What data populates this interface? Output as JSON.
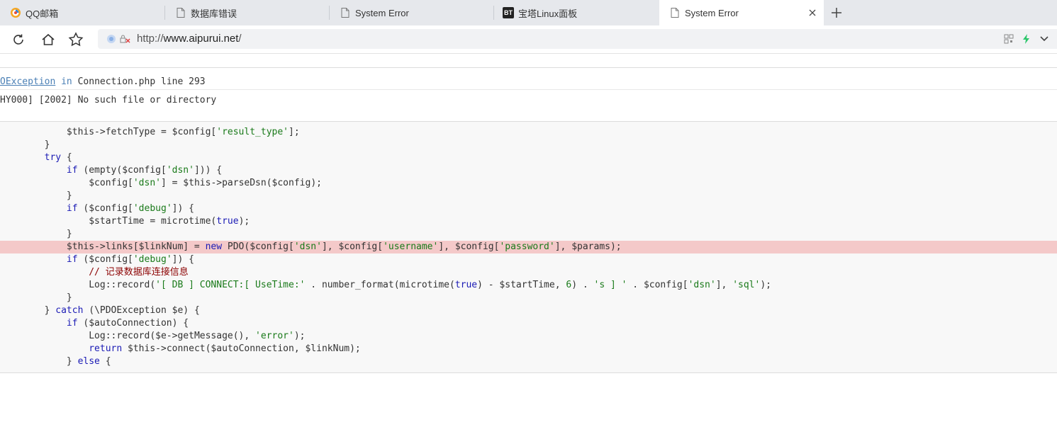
{
  "tabs": [
    {
      "label": "QQ邮箱",
      "icon": "qq-mail-icon"
    },
    {
      "label": "数据库错误",
      "icon": "page-icon"
    },
    {
      "label": "System Error",
      "icon": "page-icon"
    },
    {
      "label": "宝塔Linux面板",
      "icon": "bt-icon",
      "icon_text": "BT"
    },
    {
      "label": "System Error",
      "icon": "page-icon",
      "active": true
    }
  ],
  "address": {
    "prefix": "http://",
    "host": "www.aipurui.net",
    "suffix": "/"
  },
  "error": {
    "exception_class": "OException",
    "in_word": "in",
    "location": "Connection.php line 293",
    "message": "HY000] [2002] No such file or directory"
  },
  "code_lines": [
    {
      "indent": "            ",
      "parts": [
        [
          "p",
          "$this->fetchType = $config["
        ],
        [
          "s",
          "'result_type'"
        ],
        [
          "p",
          "];"
        ]
      ]
    },
    {
      "indent": "        ",
      "parts": [
        [
          "p",
          "}"
        ]
      ]
    },
    {
      "indent": "        ",
      "parts": [
        [
          "k",
          "try"
        ],
        [
          "p",
          " {"
        ]
      ]
    },
    {
      "indent": "            ",
      "parts": [
        [
          "k",
          "if"
        ],
        [
          "p",
          " (empty($config["
        ],
        [
          "s",
          "'dsn'"
        ],
        [
          "p",
          "])) {"
        ]
      ]
    },
    {
      "indent": "                ",
      "parts": [
        [
          "p",
          "$config["
        ],
        [
          "s",
          "'dsn'"
        ],
        [
          "p",
          "] = $this->parseDsn($config);"
        ]
      ]
    },
    {
      "indent": "            ",
      "parts": [
        [
          "p",
          "}"
        ]
      ]
    },
    {
      "indent": "            ",
      "parts": [
        [
          "k",
          "if"
        ],
        [
          "p",
          " ($config["
        ],
        [
          "s",
          "'debug'"
        ],
        [
          "p",
          "]) {"
        ]
      ]
    },
    {
      "indent": "                ",
      "parts": [
        [
          "p",
          "$startTime = microtime("
        ],
        [
          "k",
          "true"
        ],
        [
          "p",
          ");"
        ]
      ]
    },
    {
      "indent": "            ",
      "parts": [
        [
          "p",
          "}"
        ]
      ]
    },
    {
      "indent": "            ",
      "hl": true,
      "parts": [
        [
          "p",
          "$this->links[$linkNum] = "
        ],
        [
          "k",
          "new"
        ],
        [
          "p",
          " PDO($config["
        ],
        [
          "s",
          "'dsn'"
        ],
        [
          "p",
          "], $config["
        ],
        [
          "s",
          "'username'"
        ],
        [
          "p",
          "], $config["
        ],
        [
          "s",
          "'password'"
        ],
        [
          "p",
          "], $params);"
        ]
      ]
    },
    {
      "indent": "            ",
      "parts": [
        [
          "k",
          "if"
        ],
        [
          "p",
          " ($config["
        ],
        [
          "s",
          "'debug'"
        ],
        [
          "p",
          "]) {"
        ]
      ]
    },
    {
      "indent": "                ",
      "parts": [
        [
          "c",
          "// 记录数据库连接信息"
        ]
      ]
    },
    {
      "indent": "                ",
      "parts": [
        [
          "p",
          "Log::record("
        ],
        [
          "s",
          "'[ DB ] CONNECT:[ UseTime:'"
        ],
        [
          "p",
          " . number_format(microtime("
        ],
        [
          "k",
          "true"
        ],
        [
          "p",
          ") - $startTime, "
        ],
        [
          "n",
          "6"
        ],
        [
          "p",
          ") . "
        ],
        [
          "s",
          "'s ] '"
        ],
        [
          "p",
          " . $config["
        ],
        [
          "s",
          "'dsn'"
        ],
        [
          "p",
          "], "
        ],
        [
          "s",
          "'sql'"
        ],
        [
          "p",
          ");"
        ]
      ]
    },
    {
      "indent": "            ",
      "parts": [
        [
          "p",
          "}"
        ]
      ]
    },
    {
      "indent": "        ",
      "parts": [
        [
          "p",
          "} "
        ],
        [
          "k",
          "catch"
        ],
        [
          "p",
          " (\\PDOException $e) {"
        ]
      ]
    },
    {
      "indent": "            ",
      "parts": [
        [
          "k",
          "if"
        ],
        [
          "p",
          " ($autoConnection) {"
        ]
      ]
    },
    {
      "indent": "                ",
      "parts": [
        [
          "p",
          "Log::record($e->getMessage(), "
        ],
        [
          "s",
          "'error'"
        ],
        [
          "p",
          ");"
        ]
      ]
    },
    {
      "indent": "                ",
      "parts": [
        [
          "k",
          "return"
        ],
        [
          "p",
          " $this->connect($autoConnection, $linkNum);"
        ]
      ]
    },
    {
      "indent": "            ",
      "parts": [
        [
          "p",
          "} "
        ],
        [
          "k",
          "else"
        ],
        [
          "p",
          " {"
        ]
      ]
    }
  ]
}
